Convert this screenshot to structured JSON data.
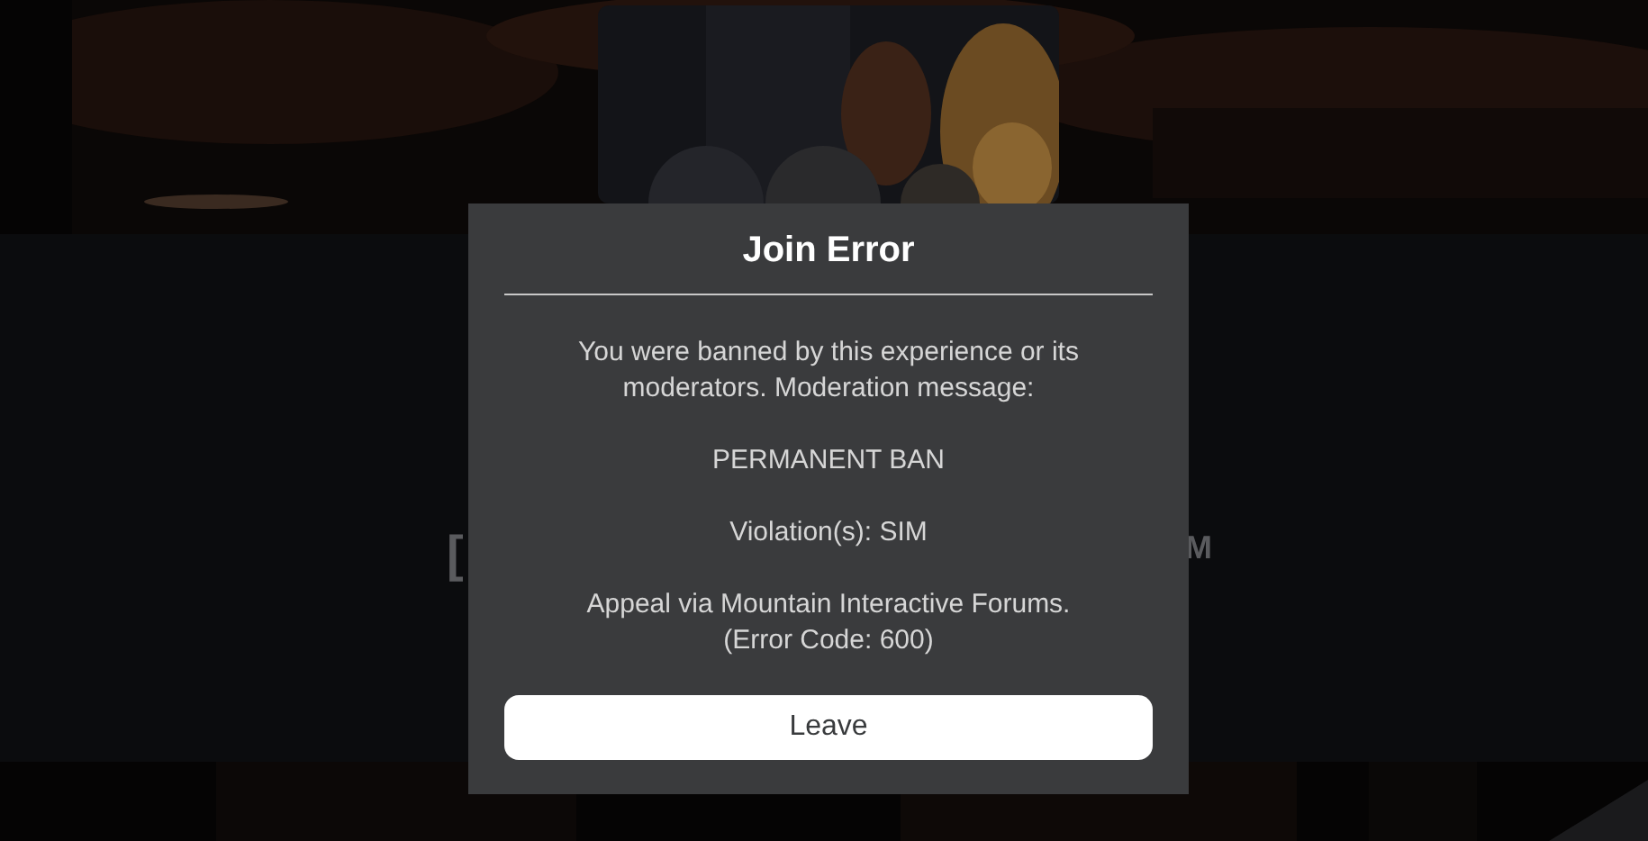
{
  "background": {
    "left_fragment": "[",
    "right_fragment": "M"
  },
  "dialog": {
    "title": "Join Error",
    "paragraphs": [
      {
        "lines": [
          "You were banned by this experience or its",
          "moderators. Moderation message:"
        ]
      },
      {
        "lines": [
          "PERMANENT BAN"
        ]
      },
      {
        "lines": [
          "Violation(s): SIM"
        ]
      },
      {
        "lines": [
          "Appeal via Mountain Interactive Forums.",
          "(Error Code: 600)"
        ]
      }
    ],
    "buttons": [
      "Leave"
    ]
  }
}
